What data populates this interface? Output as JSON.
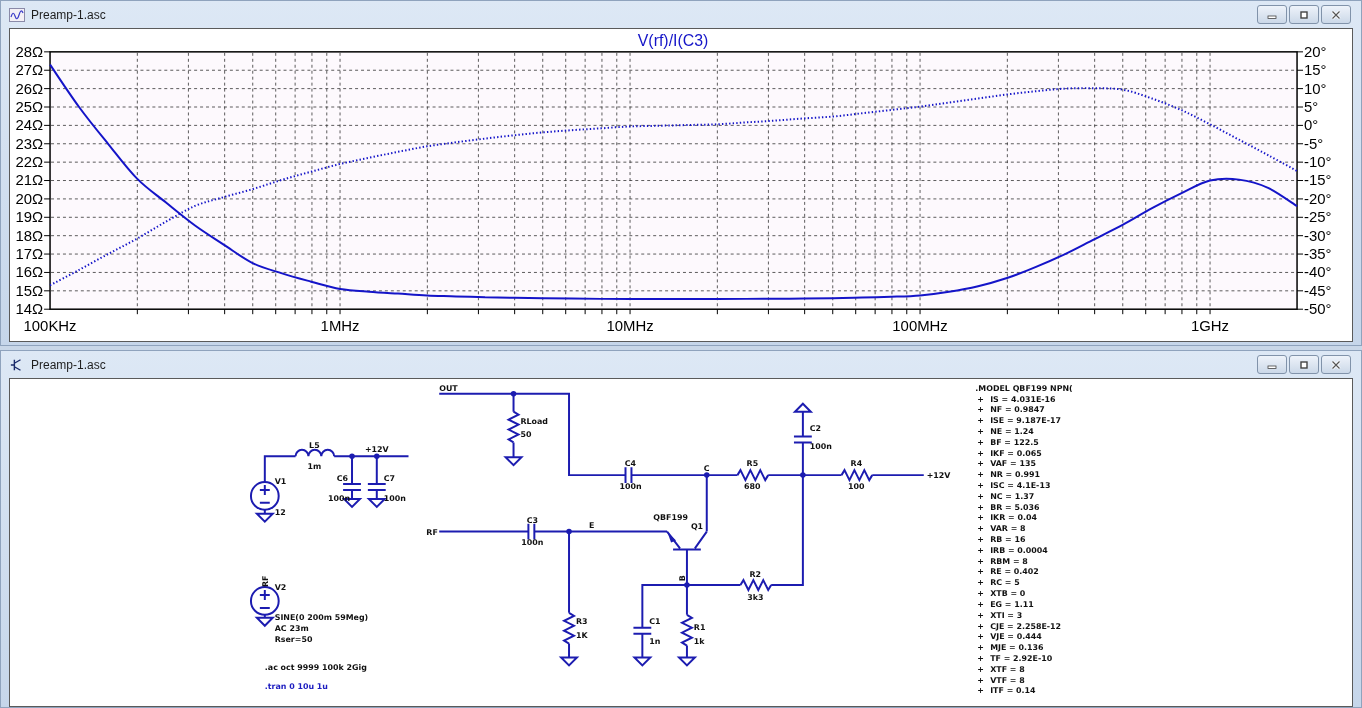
{
  "plot_window": {
    "title": "Preamp-1.asc",
    "chart_data": {
      "type": "line",
      "title": "V(rf)/I(C3)",
      "categories": [
        "100KHz",
        null,
        null,
        null,
        null,
        null,
        null,
        null,
        null,
        null,
        "1MHz",
        null,
        null,
        null,
        null,
        null,
        null,
        null,
        null,
        null,
        "10MHz",
        null,
        null,
        null,
        null,
        null,
        null,
        null,
        null,
        null,
        "100MHz",
        null,
        null,
        null,
        null,
        null,
        null,
        null,
        null,
        null,
        "1GHz",
        null,
        null,
        null
      ],
      "grid": true,
      "ylim": [
        14,
        28
      ],
      "yticks": [
        {
          "value": 14,
          "label": "14Ω"
        },
        {
          "value": 15,
          "label": "15Ω"
        },
        {
          "value": 16,
          "label": "16Ω"
        },
        {
          "value": 17,
          "label": "17Ω"
        },
        {
          "value": 18,
          "label": "18Ω"
        },
        {
          "value": 19,
          "label": "19Ω"
        },
        {
          "value": 20,
          "label": "20Ω"
        },
        {
          "value": 21,
          "label": "21Ω"
        },
        {
          "value": 22,
          "label": "22Ω"
        },
        {
          "value": 23,
          "label": "23Ω"
        },
        {
          "value": 24,
          "label": "24Ω"
        },
        {
          "value": 25,
          "label": "25Ω"
        },
        {
          "value": 26,
          "label": "26Ω"
        },
        {
          "value": 27,
          "label": "27Ω"
        },
        {
          "value": 28,
          "label": "28Ω"
        }
      ],
      "y2lim": [
        -50,
        20
      ],
      "y2ticks": [
        {
          "value": -50,
          "label": "-50°"
        },
        {
          "value": -45,
          "label": "-45°"
        },
        {
          "value": -40,
          "label": "-40°"
        },
        {
          "value": -35,
          "label": "-35°"
        },
        {
          "value": -30,
          "label": "-30°"
        },
        {
          "value": -25,
          "label": "-25°"
        },
        {
          "value": -20,
          "label": "-20°"
        },
        {
          "value": -15,
          "label": "-15°"
        },
        {
          "value": -10,
          "label": "-10°"
        },
        {
          "value": -5,
          "label": "-5°"
        },
        {
          "value": 0,
          "label": "0°"
        },
        {
          "value": 5,
          "label": "5°"
        },
        {
          "value": 10,
          "label": "10°"
        },
        {
          "value": 15,
          "label": "15°"
        },
        {
          "value": 20,
          "label": "20°"
        }
      ],
      "series": [
        {
          "color": "#1414c8",
          "line_style": "solid",
          "values": [
            27.3,
            25.0,
            23.0,
            21.1,
            19.8,
            18.55,
            17.5,
            16.5,
            15.95,
            15.5,
            15.1,
            14.95,
            14.85,
            14.75,
            14.7,
            14.65,
            14.62,
            14.6,
            14.58,
            14.56,
            14.55,
            14.55,
            14.55,
            14.55,
            14.56,
            14.57,
            14.58,
            14.6,
            14.63,
            14.68,
            14.75,
            14.95,
            15.25,
            15.7,
            16.3,
            17.0,
            17.8,
            18.6,
            19.5,
            20.3,
            21.0,
            21.05,
            20.6,
            19.6
          ]
        },
        {
          "color": "#1414c8",
          "axis": "y2",
          "line_style": "dotted",
          "values": [
            -43.5,
            -39.3,
            -35.0,
            -30.8,
            -26.2,
            -21.9,
            -19.5,
            -17.3,
            -14.8,
            -12.6,
            -10.5,
            -8.8,
            -7.2,
            -5.7,
            -4.6,
            -3.6,
            -2.7,
            -1.9,
            -1.3,
            -0.8,
            -0.3,
            -0.1,
            0.1,
            0.3,
            0.8,
            1.3,
            1.9,
            2.4,
            3.3,
            4.2,
            5.1,
            6.2,
            7.3,
            8.4,
            9.3,
            10.0,
            10.1,
            9.7,
            7.3,
            4.2,
            0.3,
            -3.9,
            -8.1,
            -12.4
          ]
        }
      ]
    }
  },
  "schematic_window": {
    "title": "Preamp-1.asc",
    "net_labels": [
      "RF",
      "+12V",
      "RF",
      "OUT",
      "E",
      "B",
      "C",
      "+12V"
    ],
    "components": [
      {
        "kind": "voltage_source",
        "name": "V1",
        "value": "12"
      },
      {
        "kind": "voltage_source",
        "name": "V2",
        "value_lines": [
          "SINE(0 200m 59Meg)",
          "AC 23m",
          "Rser=50"
        ]
      },
      {
        "kind": "inductor",
        "name": "L5",
        "value": "1m"
      },
      {
        "kind": "capacitor",
        "name": "C6",
        "value": "100n"
      },
      {
        "kind": "capacitor",
        "name": "C7",
        "value": "100n"
      },
      {
        "kind": "resistor",
        "name": "RLoad",
        "value": "50"
      },
      {
        "kind": "capacitor",
        "name": "C3",
        "value": "100n"
      },
      {
        "kind": "resistor",
        "name": "R3",
        "value": "1K"
      },
      {
        "kind": "capacitor",
        "name": "C4",
        "value": "100n"
      },
      {
        "kind": "capacitor",
        "name": "C1",
        "value": "1n"
      },
      {
        "kind": "npn",
        "name": "Q1",
        "value": "QBF199"
      },
      {
        "kind": "resistor",
        "name": "R1",
        "value": "1k"
      },
      {
        "kind": "resistor",
        "name": "R5",
        "value": "680"
      },
      {
        "kind": "resistor",
        "name": "R2",
        "value": "3k3"
      },
      {
        "kind": "capacitor",
        "name": "C2",
        "value": "100n"
      },
      {
        "kind": "resistor",
        "name": "R4",
        "value": "100"
      }
    ],
    "directives": [
      {
        "text": ".ac oct 9999 100k 2Gig",
        "commented": false
      },
      {
        "text": ".tran 0 10u 1u",
        "commented": true
      }
    ],
    "model_lines": [
      {
        "text": ".MODEL QBF199 NPN("
      },
      {
        "prefix": "+",
        "text": "IS = 4.031E-16"
      },
      {
        "prefix": "+",
        "text": "NF = 0.9847"
      },
      {
        "prefix": "+",
        "text": "ISE = 9.187E-17"
      },
      {
        "prefix": "+",
        "text": "NE = 1.24"
      },
      {
        "prefix": "+",
        "text": "BF = 122.5"
      },
      {
        "prefix": "+",
        "text": "IKF = 0.065"
      },
      {
        "prefix": "+",
        "text": "VAF = 135"
      },
      {
        "prefix": "+",
        "text": "NR = 0.991"
      },
      {
        "prefix": "+",
        "text": "ISC = 4.1E-13"
      },
      {
        "prefix": "+",
        "text": "NC = 1.37"
      },
      {
        "prefix": "+",
        "text": "BR = 5.036"
      },
      {
        "prefix": "+",
        "text": "IKR = 0.04"
      },
      {
        "prefix": "+",
        "text": "VAR = 8"
      },
      {
        "prefix": "+",
        "text": "RB = 16"
      },
      {
        "prefix": "+",
        "text": "IRB = 0.0004"
      },
      {
        "prefix": "+",
        "text": "RBM = 8"
      },
      {
        "prefix": "+",
        "text": "RE = 0.402"
      },
      {
        "prefix": "+",
        "text": "RC = 5"
      },
      {
        "prefix": "+",
        "text": "XTB = 0"
      },
      {
        "prefix": "+",
        "text": "EG = 1.11"
      },
      {
        "prefix": "+",
        "text": "XTI = 3"
      },
      {
        "prefix": "+",
        "text": "CJE = 2.258E-12"
      },
      {
        "prefix": "+",
        "text": "VJE = 0.444"
      },
      {
        "prefix": "+",
        "text": "MJE = 0.136"
      },
      {
        "prefix": "+",
        "text": "TF = 2.92E-10"
      },
      {
        "prefix": "+",
        "text": "XTF = 8"
      },
      {
        "prefix": "+",
        "text": "VTF = 8"
      },
      {
        "prefix": "+",
        "text": "ITF = 0.14"
      }
    ]
  }
}
